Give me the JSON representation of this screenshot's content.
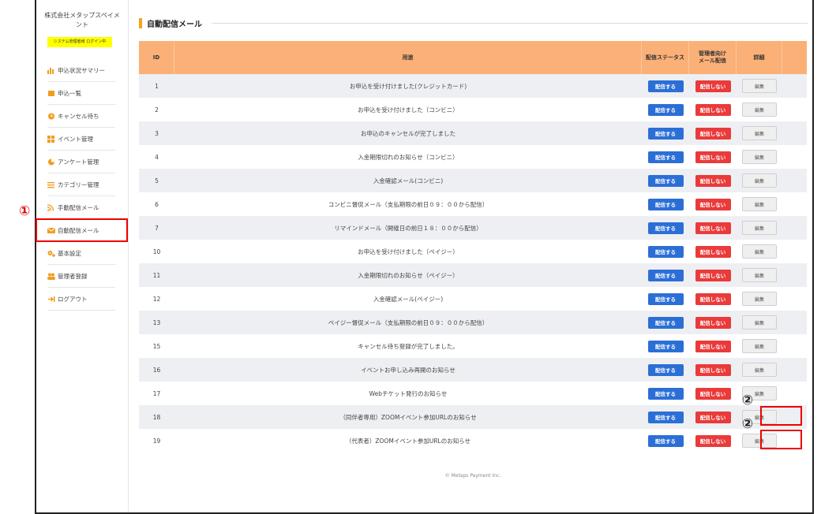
{
  "sidebar": {
    "company": "株式会社メタップスペイメント",
    "login_badge": "システム管理者様 ログイン中",
    "items": [
      {
        "label": "申込状況サマリー",
        "icon": "bar-chart-icon",
        "color": "#f29c1f"
      },
      {
        "label": "申込一覧",
        "icon": "book-icon",
        "color": "#f29c1f"
      },
      {
        "label": "キャンセル待ち",
        "icon": "clock-icon",
        "color": "#f29c1f"
      },
      {
        "label": "イベント管理",
        "icon": "grid-icon",
        "color": "#f29c1f"
      },
      {
        "label": "アンケート管理",
        "icon": "pie-chart-icon",
        "color": "#f29c1f"
      },
      {
        "label": "カテゴリー管理",
        "icon": "list-icon",
        "color": "#f29c1f"
      },
      {
        "label": "手動配信メール",
        "icon": "rss-icon",
        "color": "#f29c1f"
      },
      {
        "label": "自動配信メール",
        "icon": "envelope-icon",
        "color": "#f29c1f"
      },
      {
        "label": "基本設定",
        "icon": "gears-icon",
        "color": "#f29c1f"
      },
      {
        "label": "管理者登録",
        "icon": "users-icon",
        "color": "#f29c1f"
      },
      {
        "label": "ログアウト",
        "icon": "sign-out-icon",
        "color": "#f29c1f"
      }
    ]
  },
  "annotations": {
    "num1": "①",
    "num2": "②"
  },
  "main": {
    "title": "自動配信メール",
    "headers": {
      "id": "ID",
      "use": "用途",
      "status": "配信ステータス",
      "admin": "管理者向け\nメール配信",
      "detail": "詳細"
    },
    "rows": [
      {
        "id": "1",
        "use": "お申込を受け付けました(クレジットカード)",
        "status": "配信する",
        "admin": "配信しない",
        "edit": "編集"
      },
      {
        "id": "2",
        "use": "お申込を受け付けました（コンビニ）",
        "status": "配信する",
        "admin": "配信しない",
        "edit": "編集"
      },
      {
        "id": "3",
        "use": "お申込のキャンセルが完了しました",
        "status": "配信する",
        "admin": "配信しない",
        "edit": "編集"
      },
      {
        "id": "4",
        "use": "入金期限切れのお知らせ（コンビニ）",
        "status": "配信する",
        "admin": "配信しない",
        "edit": "編集"
      },
      {
        "id": "5",
        "use": "入金確認メール(コンビニ)",
        "status": "配信する",
        "admin": "配信しない",
        "edit": "編集"
      },
      {
        "id": "6",
        "use": "コンビニ督促メール（支払期限の前日０９：００から配信）",
        "status": "配信する",
        "admin": "配信しない",
        "edit": "編集"
      },
      {
        "id": "7",
        "use": "リマインドメール（開催日の前日１８：００から配信）",
        "status": "配信する",
        "admin": "配信しない",
        "edit": "編集"
      },
      {
        "id": "10",
        "use": "お申込を受け付けました（ペイジー）",
        "status": "配信する",
        "admin": "配信しない",
        "edit": "編集"
      },
      {
        "id": "11",
        "use": "入金期限切れのお知らせ（ペイジー）",
        "status": "配信する",
        "admin": "配信しない",
        "edit": "編集"
      },
      {
        "id": "12",
        "use": "入金確認メール(ペイジー)",
        "status": "配信する",
        "admin": "配信しない",
        "edit": "編集"
      },
      {
        "id": "13",
        "use": "ペイジー督促メール（支払期限の前日０９：００から配信）",
        "status": "配信する",
        "admin": "配信しない",
        "edit": "編集"
      },
      {
        "id": "15",
        "use": "キャンセル待ち登録が完了しました。",
        "status": "配信する",
        "admin": "配信しない",
        "edit": "編集"
      },
      {
        "id": "16",
        "use": "イベントお申し込み再開のお知らせ",
        "status": "配信する",
        "admin": "配信しない",
        "edit": "編集"
      },
      {
        "id": "17",
        "use": "Webチケット発行のお知らせ",
        "status": "配信する",
        "admin": "配信しない",
        "edit": "編集"
      },
      {
        "id": "18",
        "use": "（同伴者専用）ZOOMイベント参加URLのお知らせ",
        "status": "配信する",
        "admin": "配信しない",
        "edit": "編集"
      },
      {
        "id": "19",
        "use": "（代表者）ZOOMイベント参加URLのお知らせ",
        "status": "配信する",
        "admin": "配信しない",
        "edit": "編集"
      }
    ]
  },
  "footer": "© Metaps Payment Inc."
}
